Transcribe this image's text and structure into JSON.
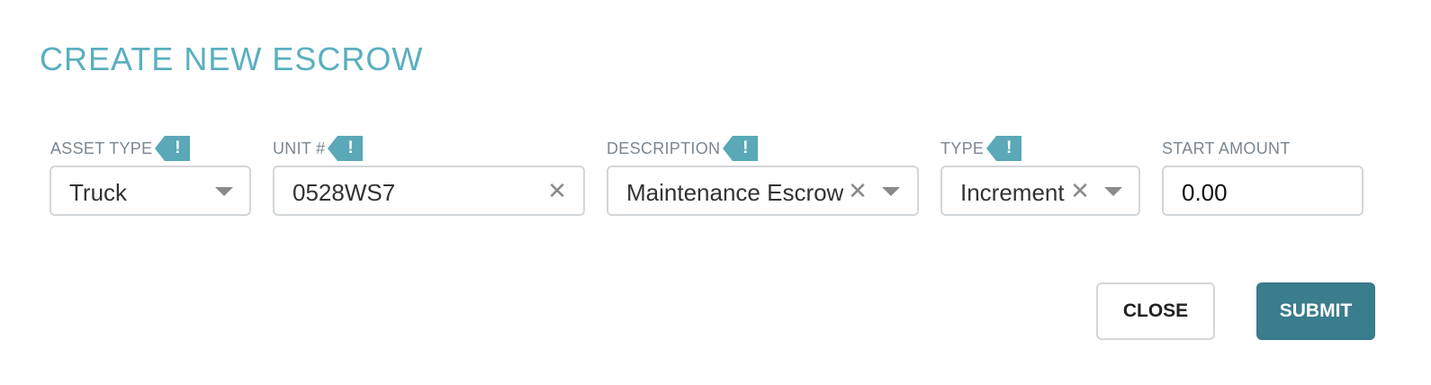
{
  "dialog": {
    "title": "CREATE NEW ESCROW"
  },
  "fields": {
    "asset_type": {
      "label": "ASSET TYPE",
      "required_mark": "!",
      "value": "Truck"
    },
    "unit": {
      "label": "UNIT #",
      "required_mark": "!",
      "value": "0528WS7",
      "clear_glyph": "✕"
    },
    "description": {
      "label": "DESCRIPTION",
      "required_mark": "!",
      "value": "Maintenance Escrow",
      "clear_glyph": "✕"
    },
    "type": {
      "label": "TYPE",
      "required_mark": "!",
      "value": "Increment",
      "clear_glyph": "✕"
    },
    "start_amount": {
      "label": "START AMOUNT",
      "value": "0.00"
    }
  },
  "buttons": {
    "close_label": "CLOSE",
    "submit_label": "SUBMIT"
  },
  "colors": {
    "title": "#5aafbf",
    "required_badge": "#5aa8b8",
    "submit_bg": "#3a7d8c",
    "border": "#d3d6d8"
  },
  "icons": {
    "required": "exclamation-icon",
    "clear": "close-icon",
    "dropdown": "chevron-down-icon"
  }
}
